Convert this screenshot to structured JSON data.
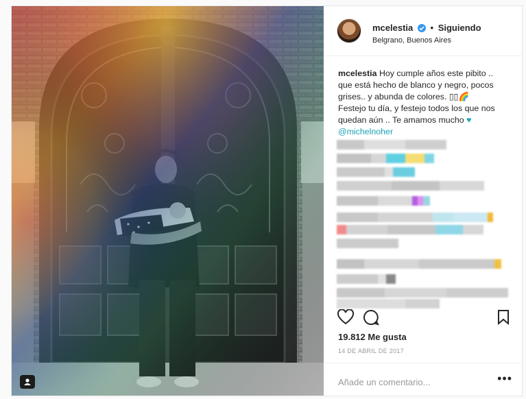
{
  "post": {
    "username": "mcelestia",
    "follow_status": "Siguiendo",
    "separator": "•",
    "location": "Belgrano, Buenos Aires",
    "caption": {
      "author": "mcelestia",
      "line1": "Hoy cumple años este pibito ..",
      "line2": "que está hecho de blanco y negro, pocos",
      "line3": "grises.. y abunda de colores. ",
      "line3_emoji": "▯▯🌈",
      "line4": "Festejo tu día, y festejo todos los que nos",
      "line5": "quedan aún .. Te amamos mucho ",
      "line5_emoji": "♥",
      "mention": "@michelnoher"
    },
    "likes": "19.812 Me gusta",
    "date": "14 DE ABRIL DE 2017",
    "comment_placeholder": "Añade un comentario...",
    "more_glyph": "•••"
  },
  "icons": {
    "verified": "verified-badge-icon",
    "like": "heart-icon",
    "comment": "comment-bubble-icon",
    "save": "bookmark-icon",
    "tag": "user-tag-icon",
    "more": "more-options-icon"
  },
  "colors": {
    "accent": "#3897f0",
    "mention": "#19a2b4",
    "muted": "#999999"
  }
}
